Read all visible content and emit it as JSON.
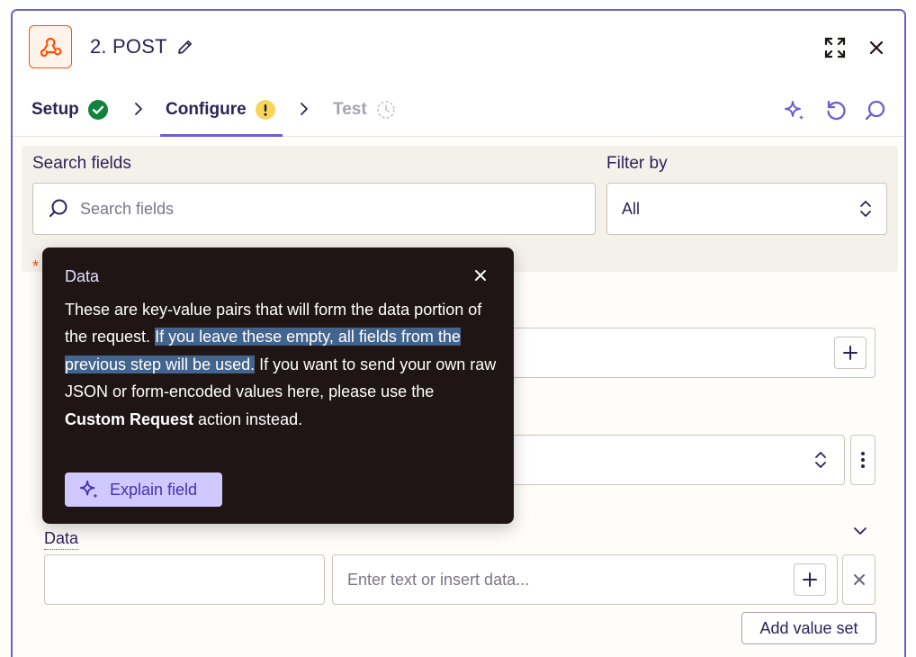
{
  "header": {
    "title": "2. POST"
  },
  "tabs": [
    {
      "label": "Setup",
      "status": "complete"
    },
    {
      "label": "Configure",
      "status": "warning"
    },
    {
      "label": "Test",
      "status": "disabled"
    }
  ],
  "search": {
    "label": "Search fields",
    "placeholder": "Search fields",
    "filter_label": "Filter by",
    "filter_value": "All"
  },
  "required_marker": "*",
  "tooltip": {
    "title": "Data",
    "text_1": "These are key-value pairs that will form the data portion of the request. ",
    "text_highlight": "If you leave these empty, all fields from the previous step will be used.",
    "text_2": " If you want to send your own raw JSON or form-encoded values here, please use the ",
    "text_bold": "Custom Request",
    "text_3": " action instead.",
    "button": "Explain field"
  },
  "data_section": {
    "label": "Data",
    "value_placeholder": "Enter text or insert data...",
    "add_button": "Add value set"
  },
  "colors": {
    "accent": "#6b5fd3",
    "brand": "#ff4f00",
    "success": "#12823b",
    "warning": "#f6d55c",
    "tooltip_bg": "#201515",
    "highlight": "#43648d"
  }
}
